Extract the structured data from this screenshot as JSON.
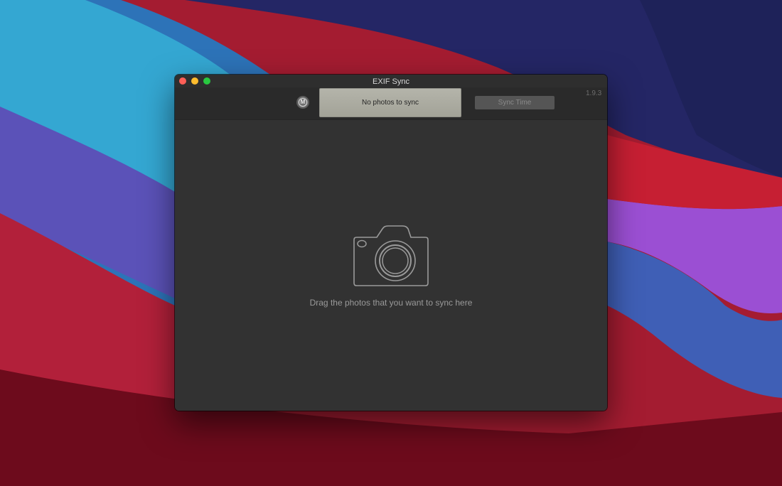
{
  "window": {
    "title": "EXIF Sync"
  },
  "toolbar": {
    "mode_button_label": "M",
    "drop_button_label": "No photos to sync",
    "sync_button_label": "Sync Time",
    "version": "1.9.3"
  },
  "drop_area": {
    "hint": "Drag the photos that you want to sync here"
  },
  "icons": {
    "camera": "camera-icon",
    "mode": "mode-icon"
  },
  "colors": {
    "window_bg": "#323232",
    "toolbar_bg": "#2a2a2a",
    "drop_button_bg": "#a9a99f",
    "close": "#fe5f57",
    "minimize": "#febc2e",
    "zoom": "#28c840"
  }
}
